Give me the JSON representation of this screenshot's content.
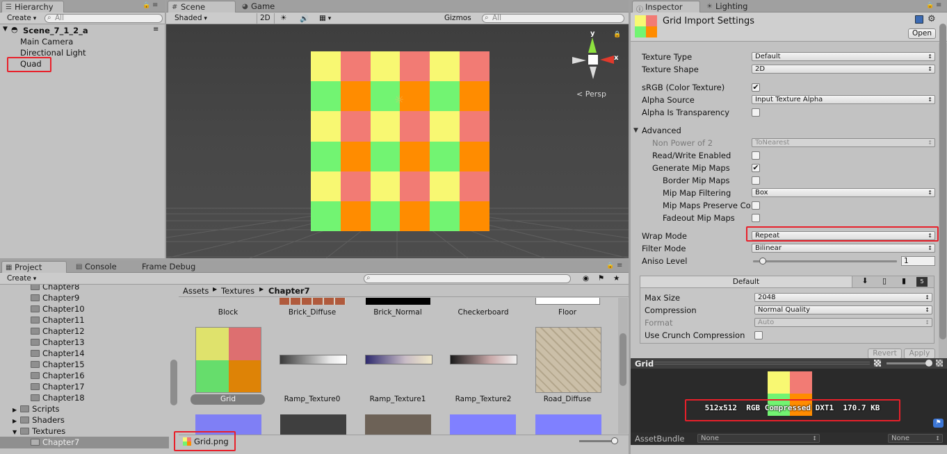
{
  "hierarchy": {
    "tab": "Hierarchy",
    "create": "Create",
    "search_placeholder": "All",
    "scene": "Scene_7_1_2_a",
    "items": [
      "Main Camera",
      "Directional Light",
      "Quad"
    ]
  },
  "scene_view": {
    "tabs": [
      "Scene",
      "Game"
    ],
    "shading": "Shaded",
    "mode_2d": "2D",
    "gizmos": "Gizmos",
    "search_placeholder": "All",
    "axis_y": "y",
    "axis_x": "x",
    "persp": "Persp",
    "grid_colors": [
      "#f8f872",
      "#f27b74",
      "#72f472",
      "#ff8c00"
    ]
  },
  "project": {
    "tabs": [
      "Project",
      "Console",
      "Frame Debug"
    ],
    "create": "Create",
    "folders": [
      "Chapter8",
      "Chapter9",
      "Chapter10",
      "Chapter11",
      "Chapter12",
      "Chapter13",
      "Chapter14",
      "Chapter15",
      "Chapter16",
      "Chapter17",
      "Chapter18"
    ],
    "root_folders": [
      "Scripts",
      "Shaders",
      "Textures"
    ],
    "selected_folder": "Chapter7",
    "breadcrumb": [
      "Assets",
      "Textures",
      "Chapter7"
    ],
    "assets_row1": [
      "Block",
      "Brick_Diffuse",
      "Brick_Normal",
      "Checkerboard",
      "Floor"
    ],
    "assets_row2": [
      "Grid",
      "Ramp_Texture0",
      "Ramp_Texture1",
      "Ramp_Texture2",
      "Road_Diffuse"
    ],
    "selected_file": "Grid.png"
  },
  "inspector": {
    "tabs": [
      "Inspector",
      "Lighting"
    ],
    "title": "Grid Import Settings",
    "open_button": "Open",
    "texture_type_label": "Texture Type",
    "texture_type": "Default",
    "texture_shape_label": "Texture Shape",
    "texture_shape": "2D",
    "srgb_label": "sRGB (Color Texture)",
    "srgb": true,
    "alpha_source_label": "Alpha Source",
    "alpha_source": "Input Texture Alpha",
    "alpha_transparency_label": "Alpha Is Transparency",
    "alpha_transparency": false,
    "advanced_label": "Advanced",
    "npot_label": "Non Power of 2",
    "npot": "ToNearest",
    "read_write_label": "Read/Write Enabled",
    "read_write": false,
    "gen_mip_label": "Generate Mip Maps",
    "gen_mip": true,
    "border_mip_label": "Border Mip Maps",
    "border_mip": false,
    "mip_filter_label": "Mip Map Filtering",
    "mip_filter": "Box",
    "mip_preserve_label": "Mip Maps Preserve Co",
    "mip_preserve": false,
    "fadeout_label": "Fadeout Mip Maps",
    "fadeout": false,
    "wrap_mode_label": "Wrap Mode",
    "wrap_mode": "Repeat",
    "filter_mode_label": "Filter Mode",
    "filter_mode": "Bilinear",
    "aniso_label": "Aniso Level",
    "aniso": "1",
    "aniso_fraction": 0.0,
    "platform_default": "Default",
    "max_size_label": "Max Size",
    "max_size": "2048",
    "compression_label": "Compression",
    "compression": "Normal Quality",
    "format_label": "Format",
    "format": "Auto",
    "crunch_label": "Use Crunch Compression",
    "crunch": false,
    "revert": "Revert",
    "apply": "Apply",
    "preview_title": "Grid",
    "preview_info": "512x512  RGB Compressed DXT1  170.7 KB",
    "assetbundle_label": "AssetBundle",
    "assetbundle": "None",
    "assetbundle_variant": "None"
  }
}
